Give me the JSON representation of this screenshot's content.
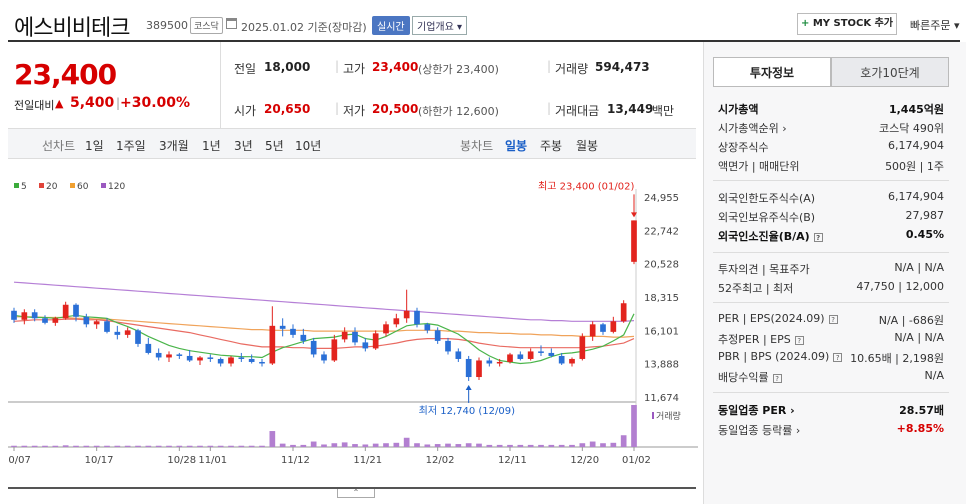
{
  "header": {
    "name": "에스비비테크",
    "code": "389500",
    "market": "코스닥",
    "date": "2025.01.02 기준(장마감)",
    "live_label": "실시간",
    "company_label": "기업개요 ▾",
    "mystock_label": "MY STOCK 추가",
    "quick_order": "빠른주문 ▾"
  },
  "price": {
    "current": "23,400",
    "change_label": "전일대비",
    "change": "5,400",
    "rate": "+30.00%"
  },
  "summary": {
    "prev": {
      "label": "전일",
      "value": "18,000"
    },
    "high": {
      "label": "고가",
      "value": "23,400",
      "note": "(상한가 23,400)"
    },
    "volume": {
      "label": "거래량",
      "value": "594,473"
    },
    "open": {
      "label": "시가",
      "value": "20,650"
    },
    "low": {
      "label": "저가",
      "value": "20,500",
      "note": "(하한가 12,600)"
    },
    "amount": {
      "label": "거래대금",
      "value": "13,449",
      "unit": "백만"
    }
  },
  "period_bar": {
    "line_label": "선차트",
    "line_items": [
      "1일",
      "1주일",
      "3개월",
      "1년",
      "3년",
      "5년",
      "10년"
    ],
    "candle_label": "봉차트",
    "candle_items": [
      "일봉",
      "주봉",
      "월봉"
    ],
    "active": "일봉"
  },
  "chart_data": {
    "type": "candlestick",
    "legend": [
      {
        "name": "5",
        "color": "#3bab3b"
      },
      {
        "name": "20",
        "color": "#e0443a"
      },
      {
        "name": "60",
        "color": "#f0a030"
      },
      {
        "name": "120",
        "color": "#9b59c0"
      }
    ],
    "y_ticks": [
      "24,955",
      "22,742",
      "20,528",
      "18,315",
      "16,101",
      "13,888",
      "11,674"
    ],
    "ylim": [
      11674,
      24955
    ],
    "x_ticks": [
      "10/07",
      "10/17",
      "10/28",
      "11/01",
      "11/12",
      "11/21",
      "12/02",
      "12/11",
      "12/20",
      "01/02"
    ],
    "x_tick_index": [
      0,
      8,
      16,
      19,
      27,
      34,
      41,
      48,
      55,
      60
    ],
    "high_label": "최고 23,400 (01/02)",
    "low_label": "최저 12,740 (12/09)",
    "volume_label": "거래량",
    "ohlc": [
      [
        17400,
        17600,
        16600,
        16800
      ],
      [
        16800,
        17500,
        16500,
        17300
      ],
      [
        17300,
        17500,
        16700,
        16900
      ],
      [
        16900,
        17100,
        16500,
        16600
      ],
      [
        16600,
        17000,
        16400,
        16900
      ],
      [
        16900,
        18000,
        16800,
        17800
      ],
      [
        17800,
        17900,
        16700,
        17000
      ],
      [
        17000,
        17200,
        16300,
        16500
      ],
      [
        16500,
        16800,
        16200,
        16700
      ],
      [
        16700,
        16900,
        15900,
        16000
      ],
      [
        16000,
        16400,
        15500,
        15800
      ],
      [
        15800,
        16300,
        15600,
        16100
      ],
      [
        16100,
        16200,
        15000,
        15200
      ],
      [
        15200,
        15600,
        14500,
        14600
      ],
      [
        14600,
        14900,
        14100,
        14300
      ],
      [
        14300,
        14700,
        14000,
        14500
      ],
      [
        14500,
        14600,
        14200,
        14400
      ],
      [
        14400,
        14800,
        14000,
        14100
      ],
      [
        14100,
        14400,
        13800,
        14300
      ],
      [
        14300,
        14500,
        14000,
        14200
      ],
      [
        14200,
        14300,
        13700,
        13900
      ],
      [
        13900,
        14400,
        13700,
        14300
      ],
      [
        14300,
        14600,
        14000,
        14200
      ],
      [
        14200,
        14500,
        13900,
        14000
      ],
      [
        14000,
        14200,
        13700,
        13900
      ],
      [
        13900,
        17700,
        13800,
        16400
      ],
      [
        16400,
        16900,
        15700,
        16200
      ],
      [
        16200,
        16500,
        15600,
        15800
      ],
      [
        15800,
        16200,
        15200,
        15400
      ],
      [
        15400,
        15600,
        14300,
        14500
      ],
      [
        14500,
        14700,
        13900,
        14100
      ],
      [
        14100,
        15800,
        14000,
        15500
      ],
      [
        15500,
        16300,
        15300,
        16000
      ],
      [
        16000,
        16300,
        15100,
        15300
      ],
      [
        15300,
        15600,
        14700,
        14900
      ],
      [
        14900,
        16100,
        14800,
        15900
      ],
      [
        15900,
        16700,
        15700,
        16500
      ],
      [
        16500,
        17200,
        16300,
        16900
      ],
      [
        16900,
        18800,
        16600,
        17400
      ],
      [
        17400,
        17600,
        16300,
        16500
      ],
      [
        16500,
        16600,
        15900,
        16100
      ],
      [
        16100,
        16300,
        15200,
        15400
      ],
      [
        15400,
        15600,
        14500,
        14700
      ],
      [
        14700,
        14900,
        14000,
        14200
      ],
      [
        14200,
        14400,
        12740,
        13000
      ],
      [
        13000,
        14300,
        12800,
        14100
      ],
      [
        14100,
        14300,
        13700,
        13900
      ],
      [
        13900,
        14200,
        13700,
        14000
      ],
      [
        14000,
        14600,
        13900,
        14500
      ],
      [
        14500,
        14700,
        14100,
        14200
      ],
      [
        14200,
        14900,
        14100,
        14700
      ],
      [
        14700,
        15100,
        14400,
        14600
      ],
      [
        14600,
        14900,
        14300,
        14400
      ],
      [
        14400,
        14600,
        13800,
        13900
      ],
      [
        13900,
        14300,
        13700,
        14200
      ],
      [
        14200,
        15900,
        14100,
        15700
      ],
      [
        15700,
        16700,
        15400,
        16500
      ],
      [
        16500,
        16600,
        15800,
        16000
      ],
      [
        16000,
        17000,
        15900,
        16700
      ],
      [
        16700,
        18100,
        16600,
        17900
      ],
      [
        20650,
        23400,
        20500,
        23400
      ]
    ],
    "volume": [
      3,
      3,
      3,
      3,
      3,
      4,
      3,
      3,
      3,
      3,
      3,
      3,
      3,
      3,
      3,
      3,
      3,
      3,
      3,
      3,
      3,
      3,
      3,
      3,
      3,
      38,
      8,
      5,
      5,
      13,
      6,
      9,
      11,
      7,
      6,
      8,
      9,
      10,
      22,
      9,
      6,
      7,
      8,
      7,
      9,
      8,
      5,
      5,
      5,
      5,
      5,
      5,
      5,
      5,
      5,
      9,
      13,
      9,
      10,
      28,
      100
    ],
    "ma5": [
      17100,
      17000,
      16950,
      16950,
      16900,
      17000,
      17100,
      17000,
      16950,
      16900,
      16600,
      16350,
      16050,
      15700,
      15400,
      15100,
      14900,
      14750,
      14650,
      14550,
      14450,
      14400,
      14350,
      14350,
      14300,
      14650,
      14950,
      15150,
      15350,
      15550,
      15600,
      15650,
      15800,
      15850,
      15550,
      15450,
      15700,
      16050,
      16400,
      16500,
      16550,
      16450,
      16150,
      15850,
      15350,
      14800,
      14400,
      14100,
      14000,
      13900,
      13950,
      14100,
      14350,
      14550,
      14600,
      14700,
      14850,
      15050,
      15400,
      15800,
      17200
    ],
    "ma20": [
      16700,
      16750,
      16800,
      16800,
      16800,
      16850,
      16850,
      16800,
      16800,
      16750,
      16650,
      16550,
      16450,
      16350,
      16250,
      16150,
      16050,
      15950,
      15800,
      15650,
      15500,
      15350,
      15200,
      15100,
      15000,
      15000,
      15000,
      14950,
      14950,
      14900,
      14900,
      14900,
      14950,
      15000,
      15000,
      15050,
      15150,
      15250,
      15400,
      15500,
      15550,
      15550,
      15550,
      15500,
      15400,
      15250,
      15150,
      15050,
      15000,
      14950,
      14950,
      14950,
      14950,
      14950,
      14950,
      14950,
      15000,
      15050,
      15150,
      15250,
      15550
    ],
    "ma60": [
      17000,
      17000,
      17000,
      16950,
      16950,
      16950,
      16900,
      16900,
      16850,
      16850,
      16800,
      16750,
      16700,
      16650,
      16600,
      16550,
      16500,
      16450,
      16400,
      16350,
      16300,
      16250,
      16200,
      16150,
      16150,
      16100,
      16100,
      16100,
      16100,
      16050,
      16050,
      16050,
      16050,
      16050,
      16050,
      16050,
      16050,
      16050,
      16100,
      16100,
      16100,
      16100,
      16050,
      16050,
      16000,
      15950,
      15950,
      15900,
      15900,
      15850,
      15850,
      15800,
      15800,
      15750,
      15750,
      15700,
      15700,
      15700,
      15650,
      15650,
      15700
    ],
    "ma120": [
      19300,
      19250,
      19200,
      19150,
      19100,
      19050,
      19000,
      18950,
      18900,
      18850,
      18800,
      18750,
      18700,
      18650,
      18600,
      18550,
      18500,
      18450,
      18400,
      18350,
      18300,
      18250,
      18200,
      18150,
      18100,
      18050,
      18000,
      17950,
      17900,
      17850,
      17800,
      17750,
      17700,
      17650,
      17600,
      17550,
      17500,
      17450,
      17400,
      17350,
      17300,
      17250,
      17200,
      17150,
      17100,
      17050,
      17000,
      16950,
      16900,
      16850,
      16800,
      16800,
      16750,
      16750,
      16700,
      16700,
      16700,
      16700,
      16700,
      16700,
      16750
    ]
  },
  "invest": {
    "tab_active": "투자정보",
    "tab_other": "호가10단계",
    "rows1": [
      {
        "label": "시가총액",
        "value": "1,445억원",
        "bold": true
      },
      {
        "label": "시가총액순위 ›",
        "value": "코스닥 490위"
      },
      {
        "label": "상장주식수",
        "value": "6,174,904"
      },
      {
        "label": "액면가 | 매매단위",
        "value": "500원 | 1주"
      }
    ],
    "rows2": [
      {
        "label": "외국인한도주식수(A)",
        "value": "6,174,904"
      },
      {
        "label": "외국인보유주식수(B)",
        "value": "27,987"
      },
      {
        "label": "외국인소진율(B/A)",
        "value": "0.45%",
        "bold": true
      }
    ],
    "rows3": [
      {
        "label": "투자의견 | 목표주가",
        "value": "N/A | N/A"
      },
      {
        "label": "52주최고 | 최저",
        "value": "47,750 | 12,000"
      }
    ],
    "rows4": [
      {
        "label": "PER | EPS(2024.09)",
        "value": "N/A | -686원"
      },
      {
        "label": "추정PER | EPS",
        "value": "N/A | N/A"
      },
      {
        "label": "PBR | BPS (2024.09)",
        "value": "10.65배 | 2,198원"
      },
      {
        "label": "배당수익률",
        "value": "N/A"
      }
    ],
    "rows5": [
      {
        "label": "동일업종 PER ›",
        "value": "28.57배",
        "bold": true
      },
      {
        "label": "동일업종 등락률 ›",
        "value": "+8.85%",
        "red": true
      }
    ]
  }
}
